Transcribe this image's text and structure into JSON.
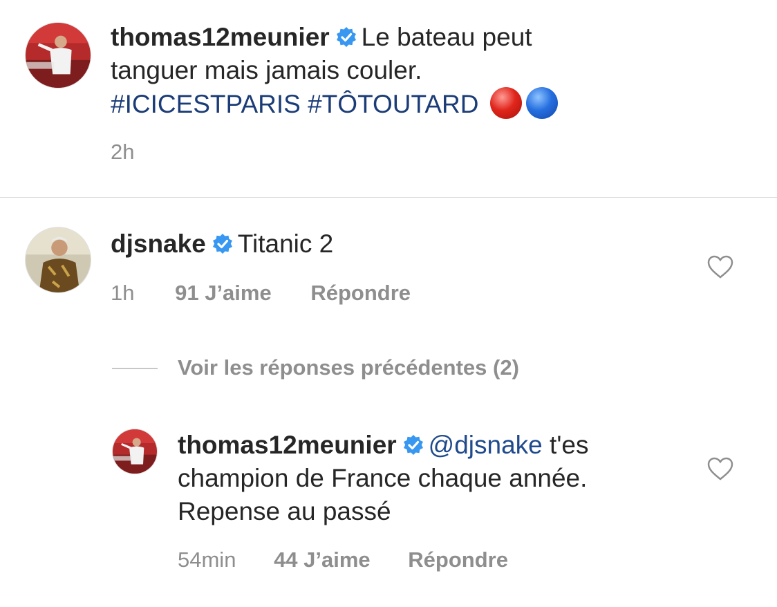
{
  "caption": {
    "username": "thomas12meunier",
    "text_line1": "Le bateau peut",
    "text_line2": "tanguer mais jamais couler.",
    "hashtags": [
      "#ICICESTPARIS",
      "#TÔTOUTARD"
    ],
    "time": "2h"
  },
  "comment": {
    "username": "djsnake",
    "text": "Titanic 2",
    "time": "1h",
    "likes": "91 J’aime",
    "reply_label": "Répondre"
  },
  "view_replies": "Voir les réponses précédentes (2)",
  "reply": {
    "username": "thomas12meunier",
    "mention": "@djsnake",
    "text_line1_rest": "t'es",
    "text_line2": "champion de France chaque année.",
    "text_line3": "Repense au passé",
    "time": "54min",
    "likes": "44 J’aime",
    "reply_label": "Répondre"
  },
  "colors": {
    "verified": "#3897f0",
    "hashtag": "#1b3c77",
    "meta_gray": "#8e8e8e",
    "divider": "#dbdbdb"
  },
  "icons": [
    "verified-badge-icon",
    "heart-icon",
    "red-circle-emoji",
    "blue-circle-emoji"
  ]
}
